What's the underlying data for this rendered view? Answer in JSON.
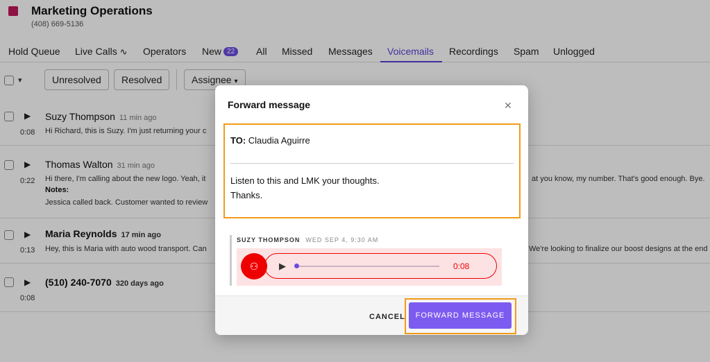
{
  "header": {
    "title": "Marketing Operations",
    "phone": "(408) 669-5136"
  },
  "tabs": [
    {
      "label": "Hold Queue"
    },
    {
      "label": "Live Calls",
      "icon": "live-wave-icon"
    },
    {
      "label": "Operators"
    },
    {
      "label": "New",
      "badge": "22"
    },
    {
      "label": "All"
    },
    {
      "label": "Missed"
    },
    {
      "label": "Messages"
    },
    {
      "label": "Voicemails",
      "active": true
    },
    {
      "label": "Recordings"
    },
    {
      "label": "Spam"
    },
    {
      "label": "Unlogged"
    }
  ],
  "toolbar": {
    "unresolved": "Unresolved",
    "resolved": "Resolved",
    "assignee": "Assignee"
  },
  "rows": [
    {
      "name": "Suzy Thompson",
      "age": "11 min ago",
      "duration": "0:08",
      "snippet": "Hi Richard, this is Suzy. I'm just returning your c"
    },
    {
      "name": "Thomas Walton",
      "age": "31 min ago",
      "duration": "0:22",
      "snippet": "Hi there, I'm calling about the new logo. Yeah, it",
      "snippet_right": "at you know, my number. That's good enough. Bye.",
      "notes_label": "Notes:",
      "notes": "Jessica called back. Customer wanted to review"
    },
    {
      "name": "Maria Reynolds",
      "age": "17 min ago",
      "duration": "0:13",
      "snippet": "Hey, this is Maria with auto wood transport. Can",
      "snippet_right": "We're looking to finalize our boost designs at the end"
    },
    {
      "name": "(510) 240-7070",
      "age": "320 days ago",
      "duration": "0:08"
    }
  ],
  "modal": {
    "title": "Forward message",
    "to_label": "TO:",
    "to_value": "Claudia Aguirre",
    "message_line1": "Listen to this and LMK your thoughts.",
    "message_line2": "Thanks.",
    "vm_from": "SUZY THOMPSON",
    "vm_date": "WED SEP 4, 9:30 AM",
    "vm_time": "0:08",
    "progress_fraction": 0.0,
    "cancel": "CANCEL",
    "forward": "FORWARD MESSAGE"
  },
  "colors": {
    "accent": "#6c4ce0",
    "highlight": "#f29b16",
    "voicemail_red": "#ee0000"
  }
}
